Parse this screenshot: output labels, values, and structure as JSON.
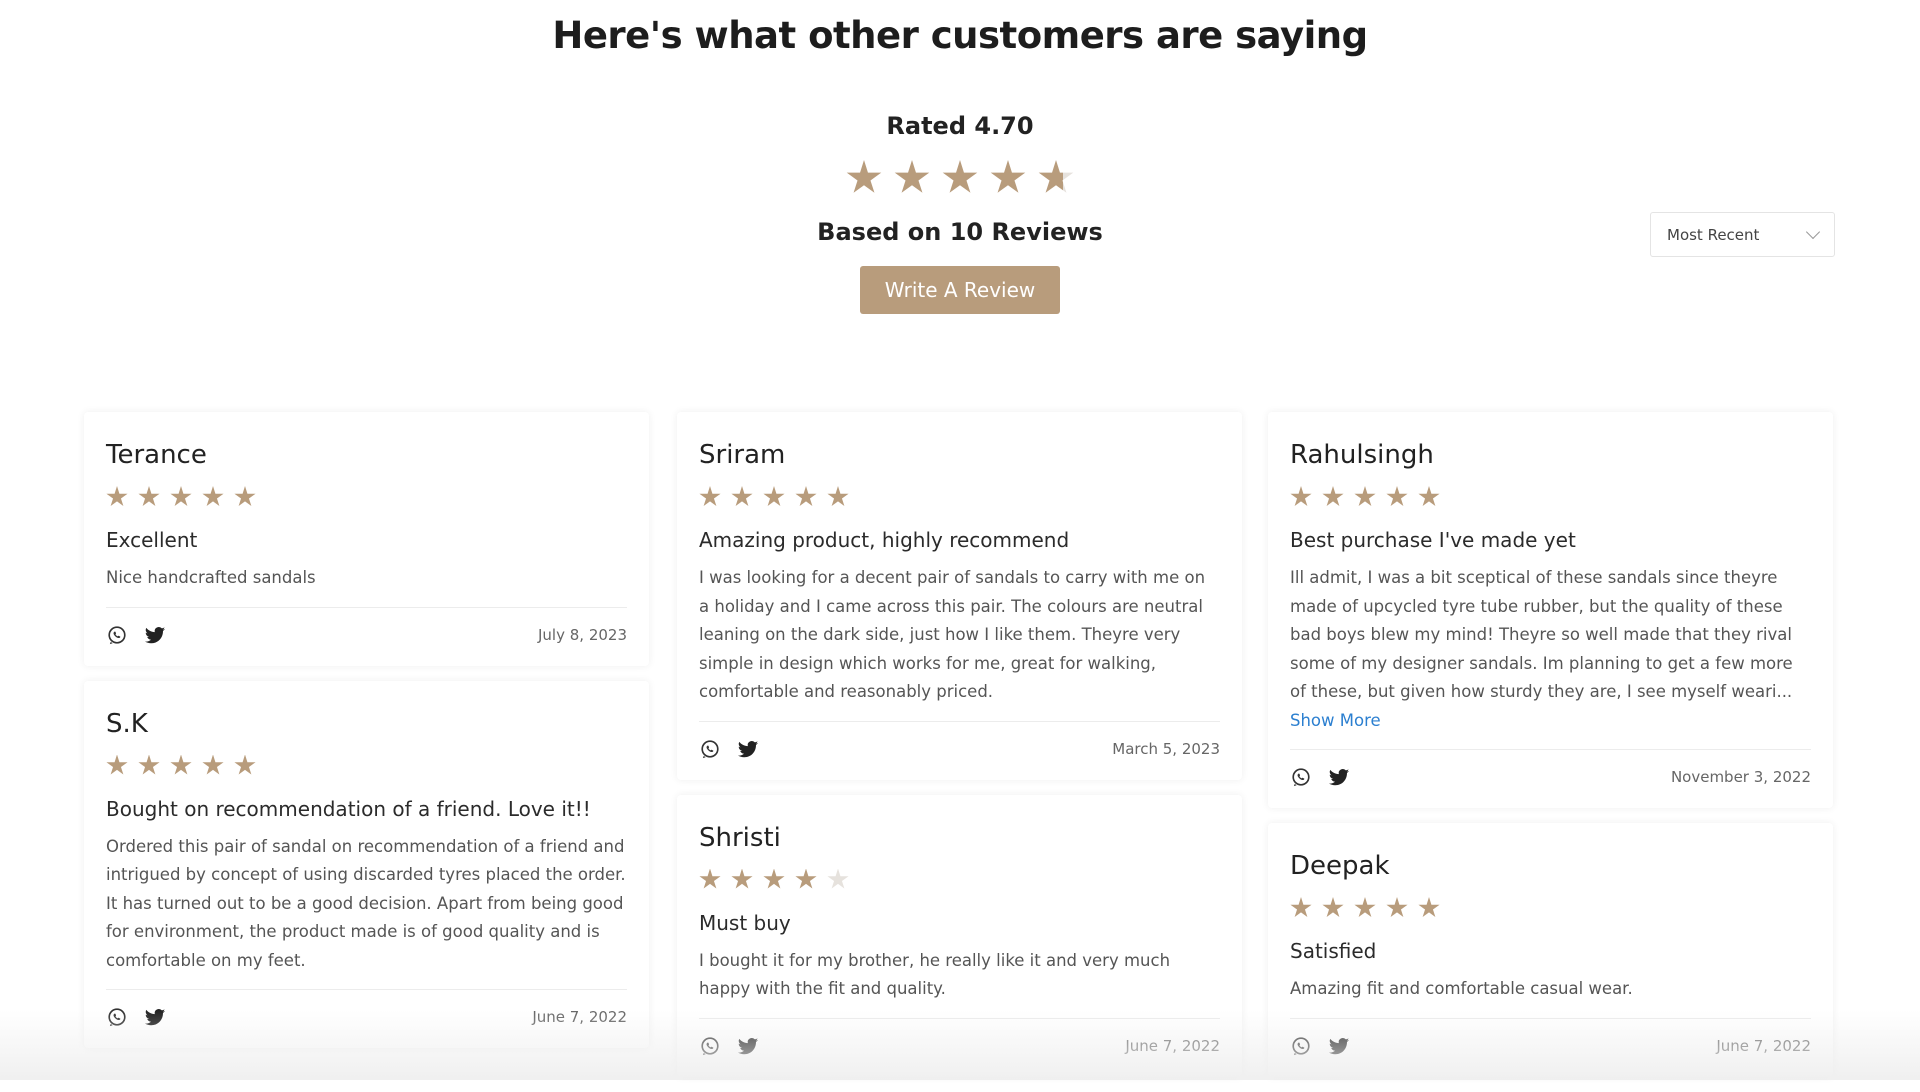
{
  "heading": "Here's what other customers are saying",
  "summary": {
    "rated_label": "Rated 4.70",
    "rating": 4.7,
    "max_rating": 5,
    "based_label": "Based on 10 Reviews",
    "write_review_label": "Write A Review"
  },
  "sort": {
    "selected": "Most Recent"
  },
  "colors": {
    "accent": "#b89c7c",
    "empty_star": "#e6e2dd",
    "link": "#2b7fd0"
  },
  "icons": {
    "share": [
      "whatsapp-icon",
      "twitter-icon"
    ],
    "sort": "chevron-down-icon"
  },
  "columns": [
    [
      {
        "name": "Terance",
        "rating": 5,
        "title": "Excellent",
        "body": "Nice handcrafted sandals",
        "date": "July 8, 2023"
      },
      {
        "name": "S.K",
        "rating": 5,
        "title": "Bought on recommendation of a friend. Love it!!",
        "body": "Ordered this pair of sandal on recommendation of a friend and intrigued by concept of using discarded tyres placed the order. It has turned out to be a good decision. Apart from being good for environment, the product made is of good quality and is comfortable on my feet.",
        "date": "June 7, 2022"
      }
    ],
    [
      {
        "name": "Sriram",
        "rating": 5,
        "title": "Amazing product, highly recommend",
        "body": "I was looking for a decent pair of sandals to carry with me on a holiday and I came across this pair. The colours are neutral leaning on the dark side, just how I like them. Theyre very simple in design which works for me, great for walking, comfortable and reasonably priced.",
        "date": "March 5, 2023"
      },
      {
        "name": "Shristi",
        "rating": 4,
        "title": "Must buy",
        "body": "I bought it for my brother, he really like it and very much happy with the fit and quality.",
        "date": "June 7, 2022"
      }
    ],
    [
      {
        "name": "Rahulsingh",
        "rating": 5,
        "title": "Best purchase I've made yet",
        "body": "Ill admit, I was a bit sceptical of these sandals since theyre made of upcycled tyre tube rubber, but the quality of these bad boys blew my mind! Theyre so well made that they rival some of my designer sandals. Im planning to get a few more of these, but given how sturdy they are, I see myself weari...",
        "show_more": "Show More",
        "date": "November 3, 2022"
      },
      {
        "name": "Deepak",
        "rating": 5,
        "title": "Satisfied",
        "body": "Amazing fit and comfortable casual wear.",
        "date": "June 7, 2022"
      }
    ]
  ]
}
